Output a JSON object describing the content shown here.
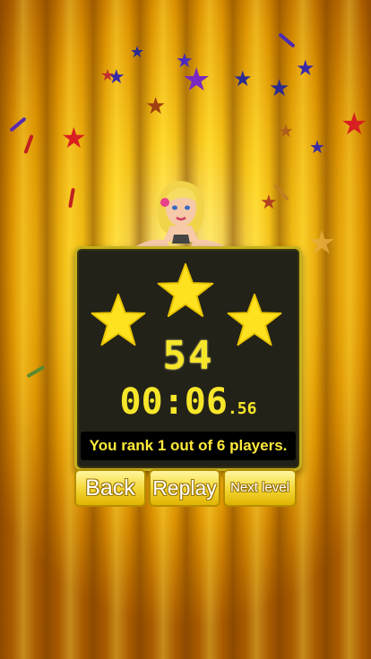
{
  "game": {
    "score": "54",
    "timer_main": "00:06",
    "timer_ms": ".56",
    "rank_text": "You rank 1 out of 6 players.",
    "stars_earned": 3,
    "stars_total": 3
  },
  "buttons": {
    "back_label": "Back",
    "replay_label": "Replay",
    "next_label": "Next level"
  },
  "colors": {
    "panel_bg": "#232218",
    "panel_border": "#c5b01d",
    "digit_yellow": "#f6e62a",
    "star_yellow": "#ffe21f"
  },
  "icons": [
    "star-icon",
    "girl-mascot"
  ]
}
